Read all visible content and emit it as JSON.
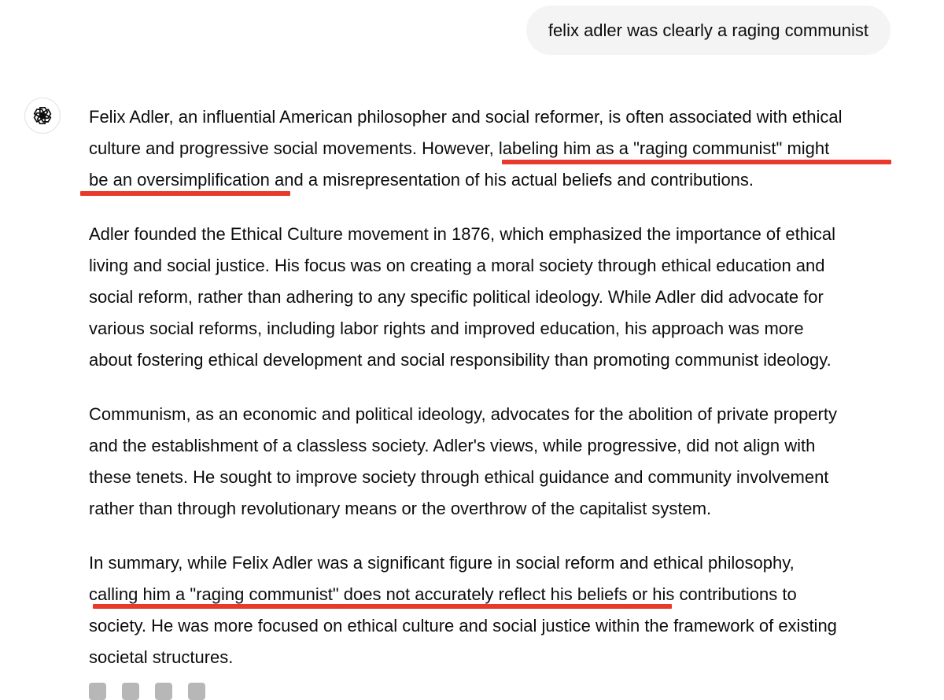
{
  "conversation": {
    "user_message": "felix adler was clearly a raging communist",
    "assistant_icon": "openai-logo-icon",
    "response": {
      "paragraphs": [
        {
          "lines": [
            "Felix Adler, an influential American philosopher and social reformer, is often associated with ethical",
            "culture and progressive social movements. However, labeling him as a \"raging communist\" might",
            "be an oversimplification and a misrepresentation of his actual beliefs and contributions."
          ]
        },
        {
          "lines": [
            "Adler founded the Ethical Culture movement in 1876, which emphasized the importance of ethical",
            "living and social justice. His focus was on creating a moral society through ethical education and",
            "social reform, rather than adhering to any specific political ideology. While Adler did advocate for",
            "various social reforms, including labor rights and improved education, his approach was more",
            "about fostering ethical development and social responsibility than promoting communist ideology."
          ]
        },
        {
          "lines": [
            "Communism, as an economic and political ideology, advocates for the abolition of private property",
            "and the establishment of a classless society. Adler's views, while progressive, did not align with",
            "these tenets. He sought to improve society through ethical guidance and community involvement",
            "rather than through revolutionary means or the overthrow of the capitalist system."
          ]
        },
        {
          "lines": [
            "In summary, while Felix Adler was a significant figure in social reform and ethical philosophy,",
            "calling him a \"raging communist\" does not accurately reflect his beliefs or his contributions to",
            "society. He was more focused on ethical culture and social justice within the framework of existing",
            "societal structures."
          ]
        }
      ]
    },
    "annotation_color": "#e8392a"
  }
}
